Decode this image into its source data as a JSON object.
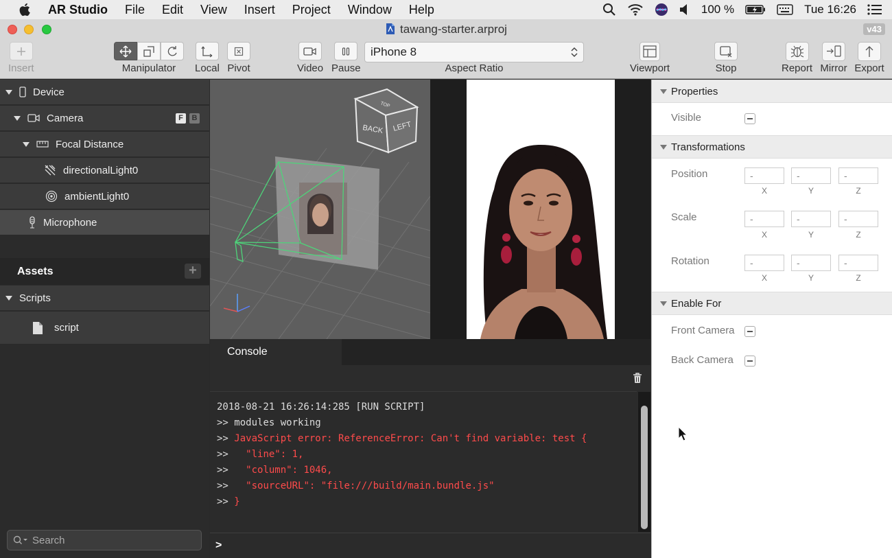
{
  "menubar": {
    "app_name": "AR Studio",
    "items": [
      "File",
      "Edit",
      "View",
      "Insert",
      "Project",
      "Window",
      "Help"
    ],
    "battery": "100 %",
    "clock": "Tue 16:26"
  },
  "window": {
    "title": "tawang-starter.arproj",
    "version": "v43"
  },
  "toolbar": {
    "insert_label": "Insert",
    "manipulator_label": "Manipulator",
    "local_label": "Local",
    "pivot_label": "Pivot",
    "video_label": "Video",
    "pause_label": "Pause",
    "device_value": "iPhone 8",
    "aspect_ratio_label": "Aspect Ratio",
    "viewport_label": "Viewport",
    "stop_label": "Stop",
    "report_label": "Report",
    "mirror_label": "Mirror",
    "export_label": "Export"
  },
  "scene_tree": {
    "device": "Device",
    "camera": "Camera",
    "camera_badges": [
      "F",
      "B"
    ],
    "focal_distance": "Focal Distance",
    "directional_light": "directionalLight0",
    "ambient_light": "ambientLight0",
    "microphone": "Microphone"
  },
  "assets": {
    "header": "Assets",
    "add_symbol": "+",
    "scripts_folder": "Scripts",
    "script_item": "script"
  },
  "search": {
    "placeholder": "Search"
  },
  "viewport": {
    "cube_faces": [
      "BACK",
      "LEFT",
      "TOP"
    ]
  },
  "console": {
    "tab_label": "Console",
    "lines": [
      {
        "text": "2018-08-21 16:26:14:285 [RUN SCRIPT]",
        "type": "info"
      },
      {
        "prefix": ">> ",
        "text": "modules working",
        "type": "info"
      },
      {
        "prefix": ">> ",
        "text": "JavaScript error: ReferenceError: Can't find variable: test {",
        "type": "error"
      },
      {
        "prefix": ">>   ",
        "text": "\"line\": 1,",
        "type": "error"
      },
      {
        "prefix": ">>   ",
        "text": "\"column\": 1046,",
        "type": "error"
      },
      {
        "prefix": ">>   ",
        "text": "\"sourceURL\": \"file:///build/main.bundle.js\"",
        "type": "error"
      },
      {
        "prefix": ">> ",
        "text": "}",
        "type": "error"
      }
    ],
    "prompt": ">"
  },
  "properties": {
    "properties_header": "Properties",
    "visible_label": "Visible",
    "transformations_header": "Transformations",
    "position_label": "Position",
    "scale_label": "Scale",
    "rotation_label": "Rotation",
    "field_value": "-",
    "axes": [
      "X",
      "Y",
      "Z"
    ],
    "enable_for_header": "Enable For",
    "front_camera_label": "Front Camera",
    "back_camera_label": "Back Camera"
  },
  "colors": {
    "error_text": "#ff4b4b",
    "panel_dark": "#3b3b3b",
    "selected_row": "#4a4a4a"
  }
}
